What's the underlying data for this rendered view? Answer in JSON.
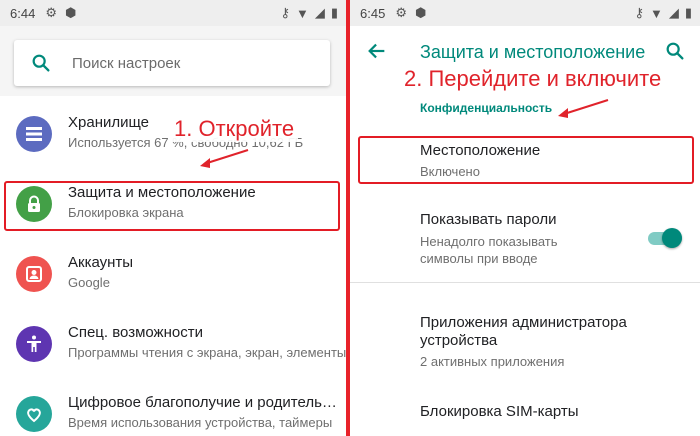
{
  "left": {
    "status": {
      "time": "6:44"
    },
    "search": {
      "placeholder": "Поиск настроек"
    },
    "items": [
      {
        "title": "Хранилище",
        "subtitle": "Используется 67 %, свободно 10,62 ГБ",
        "color": "#5c6bc0",
        "icon": "storage-icon"
      },
      {
        "title": "Защита и местоположение",
        "subtitle": "Блокировка экрана",
        "color": "#43a047",
        "icon": "lock-icon"
      },
      {
        "title": "Аккаунты",
        "subtitle": "Google",
        "color": "#ef5350",
        "icon": "account-icon"
      },
      {
        "title": "Спец. возможности",
        "subtitle": "Программы чтения с экрана, экран, элементы",
        "color": "#5e35b1",
        "icon": "accessibility-icon"
      },
      {
        "title": "Цифровое благополучие и родительский контроль",
        "subtitle": "Время использования устройства, таймеры",
        "color": "#26a69a",
        "icon": "wellbeing-icon"
      }
    ],
    "annotation": "1. Откройте"
  },
  "right": {
    "status": {
      "time": "6:45"
    },
    "title": "Защита и местоположение",
    "annotation": "2. Перейдите и включите",
    "section": "Конфиденциальность",
    "location": {
      "title": "Местоположение",
      "subtitle": "Включено"
    },
    "passwords": {
      "title": "Показывать пароли",
      "subtitle_1": "Ненадолго показывать",
      "subtitle_2": "символы при вводе",
      "on": true
    },
    "admin": {
      "title_1": "Приложения администратора",
      "title_2": "устройства",
      "subtitle": "2 активных приложения"
    },
    "sim": {
      "title": "Блокировка SIM-карты"
    }
  },
  "colors": {
    "accent": "#00897b",
    "annotation": "#e0232b"
  }
}
